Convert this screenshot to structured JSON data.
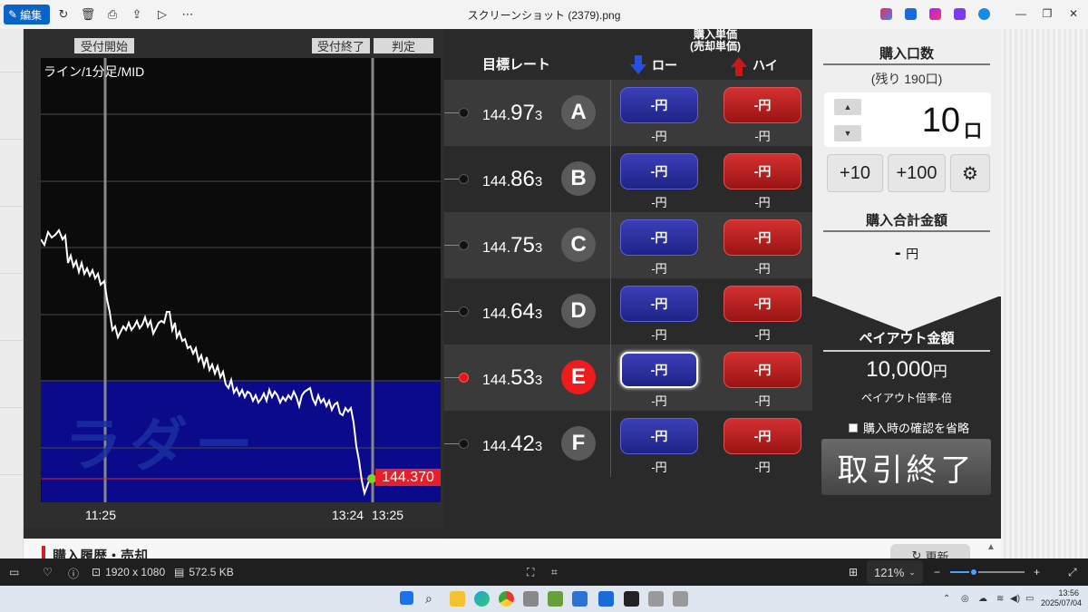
{
  "toolbar": {
    "edit_label": "編集",
    "window_title": "スクリーンショット (2379).png",
    "icons": [
      "rotate-icon",
      "delete-icon",
      "print-icon",
      "share-icon",
      "slideshow-icon",
      "more-icon"
    ]
  },
  "chart": {
    "header_accept_start": "受付開始",
    "header_accept_end": "受付終了",
    "header_judge": "判定",
    "title": "ライン/1分足/MID",
    "watermark": "ラダー",
    "current_price": "144.370",
    "time_labels": [
      "11:25",
      "13:24",
      "13:25"
    ],
    "line_color": "#ffffff",
    "zone_color": "#0a0a8a"
  },
  "rates": {
    "target_header": "目標レート",
    "buy_header_line1": "購入単価",
    "buy_header_line2": "(売却単価)",
    "low_label": "ロー",
    "high_label": "ハイ",
    "rows": [
      {
        "letter": "A",
        "rate_pre": "144.",
        "rate_big": "97",
        "rate_sub": "3",
        "low_btn": "-円",
        "high_btn": "-円",
        "low_price": "-円",
        "high_price": "-円",
        "active": false
      },
      {
        "letter": "B",
        "rate_pre": "144.",
        "rate_big": "86",
        "rate_sub": "3",
        "low_btn": "-円",
        "high_btn": "-円",
        "low_price": "-円",
        "high_price": "-円",
        "active": false
      },
      {
        "letter": "C",
        "rate_pre": "144.",
        "rate_big": "75",
        "rate_sub": "3",
        "low_btn": "-円",
        "high_btn": "-円",
        "low_price": "-円",
        "high_price": "-円",
        "active": false
      },
      {
        "letter": "D",
        "rate_pre": "144.",
        "rate_big": "64",
        "rate_sub": "3",
        "low_btn": "-円",
        "high_btn": "-円",
        "low_price": "-円",
        "high_price": "-円",
        "active": false
      },
      {
        "letter": "E",
        "rate_pre": "144.",
        "rate_big": "53",
        "rate_sub": "3",
        "low_btn": "-円",
        "high_btn": "-円",
        "low_price": "-円",
        "high_price": "-円",
        "active": true
      },
      {
        "letter": "F",
        "rate_pre": "144.",
        "rate_big": "42",
        "rate_sub": "3",
        "low_btn": "-円",
        "high_btn": "-円",
        "low_price": "-円",
        "high_price": "-円",
        "active": false
      }
    ]
  },
  "purchase": {
    "qty_header": "購入口数",
    "remaining": "(残り 190口)",
    "qty_value": "10",
    "qty_unit": "口",
    "add10": "+10",
    "add100": "+100",
    "total_header": "購入合計金額",
    "total_value": "-",
    "total_unit": "円",
    "payout_header": "ペイアウト金額",
    "payout_value": "10,000",
    "payout_unit": "円",
    "payout_rate": "ペイアウト倍率-倍",
    "skip_confirm": "購入時の確認を省略",
    "end_trade": "取引終了"
  },
  "bottom": {
    "history_label": "購入履歴・売却",
    "update_label": "更新"
  },
  "viewer": {
    "dimensions": "1920 x 1080",
    "file_size": "572.5 KB",
    "zoom": "121%",
    "zoom_level": 0.32
  },
  "taskbar": {
    "time": "13:56",
    "date": "2025/07/04"
  }
}
